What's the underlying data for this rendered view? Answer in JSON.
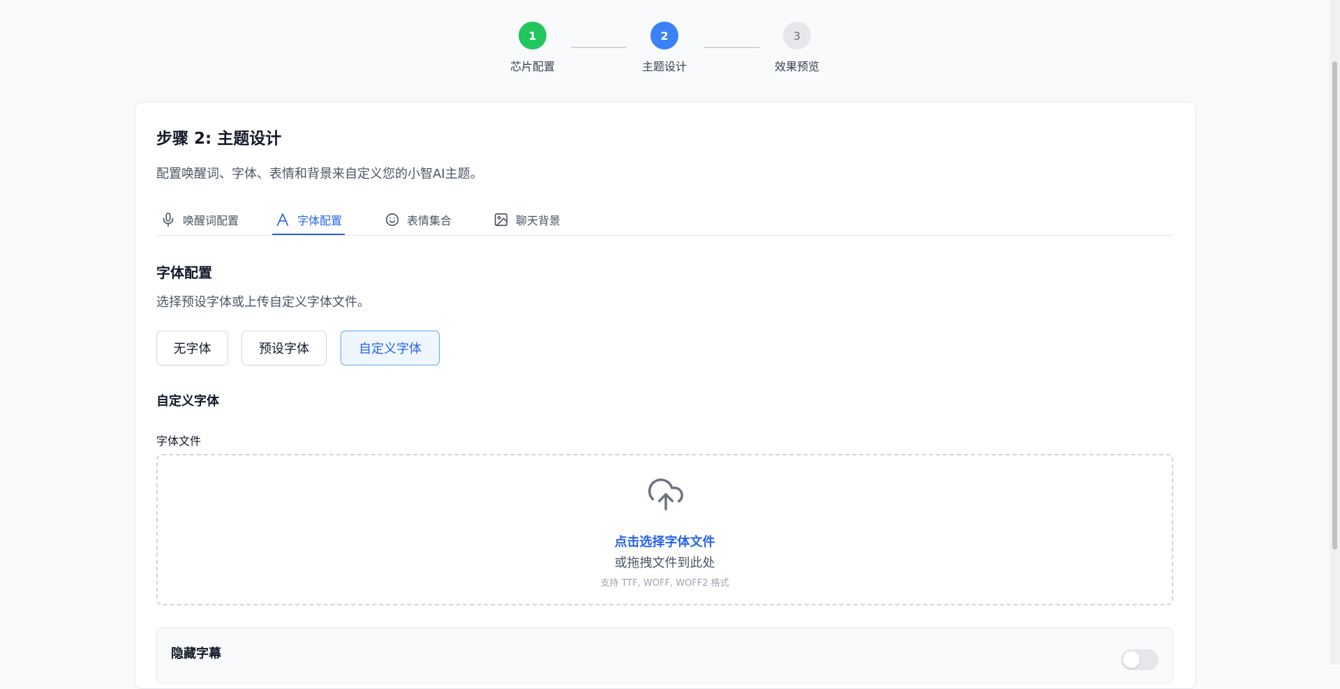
{
  "stepper": {
    "steps": [
      {
        "number": "1",
        "label": "芯片配置",
        "state": "done"
      },
      {
        "number": "2",
        "label": "主题设计",
        "state": "active"
      },
      {
        "number": "3",
        "label": "效果预览",
        "state": "todo"
      }
    ]
  },
  "card": {
    "title": "步骤 2: 主题设计",
    "description": "配置唤醒词、字体、表情和背景来自定义您的小智AI主题。"
  },
  "tabs": [
    {
      "label": "唤醒词配置",
      "icon": "microphone-icon",
      "active": false
    },
    {
      "label": "字体配置",
      "icon": "font-icon",
      "active": true
    },
    {
      "label": "表情集合",
      "icon": "smile-icon",
      "active": false
    },
    {
      "label": "聊天背景",
      "icon": "image-icon",
      "active": false
    }
  ],
  "font_section": {
    "title": "字体配置",
    "description": "选择预设字体或上传自定义字体文件。",
    "options": [
      {
        "label": "无字体",
        "selected": false
      },
      {
        "label": "预设字体",
        "selected": false
      },
      {
        "label": "自定义字体",
        "selected": true
      }
    ],
    "custom_title": "自定义字体",
    "file_label": "字体文件",
    "dropzone": {
      "icon": "cloud-upload-icon",
      "primary": "点击选择字体文件",
      "secondary": "或拖拽文件到此处",
      "hint": "支持 TTF, WOFF, WOFF2 格式"
    }
  },
  "hide_subtitle": {
    "label": "隐藏字幕",
    "enabled": false
  },
  "colors": {
    "accent": "#2563eb",
    "done": "#22c55e",
    "active_step": "#3b82f6"
  }
}
